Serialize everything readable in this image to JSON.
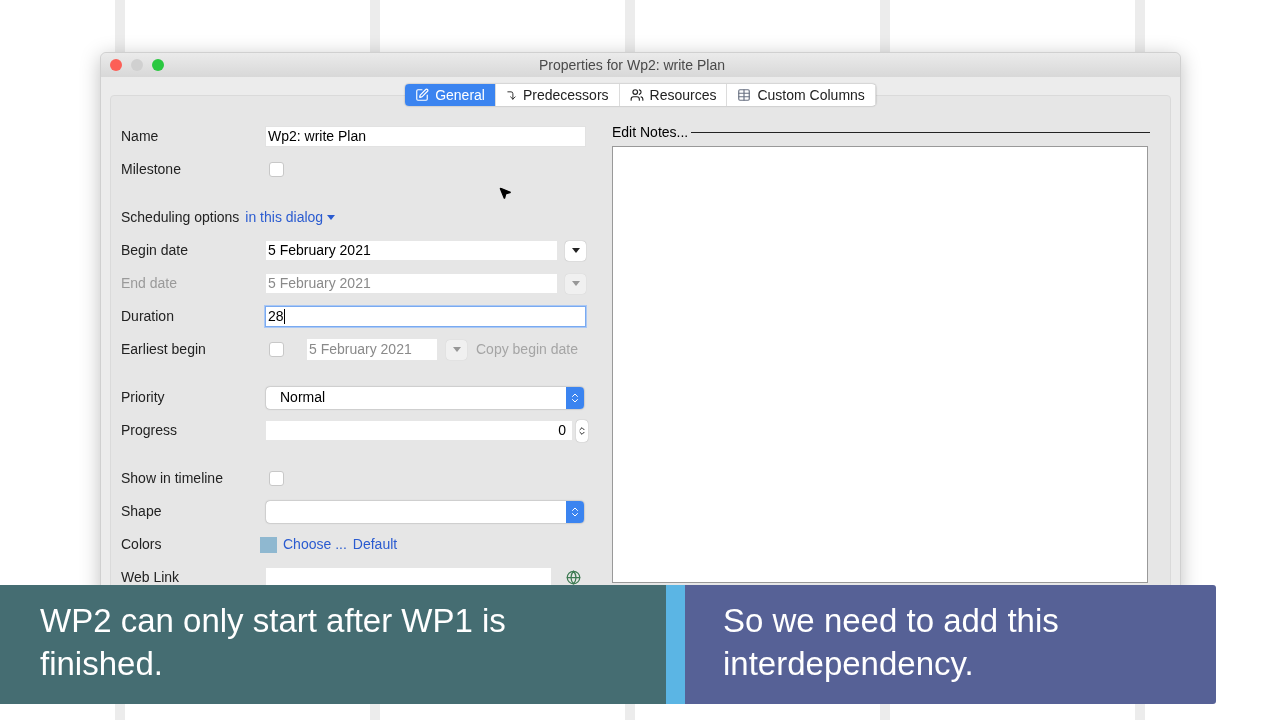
{
  "window": {
    "title": "Properties for Wp2: write Plan"
  },
  "tabs": [
    {
      "label": "General",
      "selected": true
    },
    {
      "label": "Predecessors",
      "selected": false
    },
    {
      "label": "Resources",
      "selected": false
    },
    {
      "label": "Custom Columns",
      "selected": false
    }
  ],
  "form": {
    "sections": [
      [
        {
          "kind": "text",
          "label": "Name",
          "value": "Wp2: write Plan",
          "focused": false
        },
        {
          "kind": "checkbox",
          "label": "Milestone",
          "checked": false
        }
      ],
      [
        {
          "kind": "link",
          "label": "Scheduling options",
          "link": "in this dialog"
        },
        {
          "kind": "date",
          "label": "Begin date",
          "value": "5 February 2021",
          "disabled": false
        },
        {
          "kind": "date",
          "label": "End date",
          "value": "5 February 2021",
          "disabled": true
        },
        {
          "kind": "text",
          "label": "Duration",
          "value": "28",
          "focused": true
        },
        {
          "kind": "earliest",
          "label": "Earliest begin",
          "checked": false,
          "value": "5 February 2021",
          "link": "Copy begin date"
        }
      ],
      [
        {
          "kind": "select",
          "label": "Priority",
          "value": "Normal"
        },
        {
          "kind": "spinner",
          "label": "Progress",
          "value": "0"
        }
      ],
      [
        {
          "kind": "checkbox",
          "label": "Show in timeline",
          "checked": false
        },
        {
          "kind": "select",
          "label": "Shape"
        },
        {
          "kind": "colors",
          "label": "Colors",
          "color": "#8fb8d0",
          "links": [
            "Choose ...",
            "Default"
          ]
        },
        {
          "kind": "weblink",
          "label": "Web Link"
        }
      ]
    ]
  },
  "notes": {
    "title": "Edit Notes..."
  },
  "captions": [
    {
      "text": "WP2 can only start after WP1 is finished.",
      "color": "#456d72"
    },
    {
      "text": "So we need to add this interdependency.",
      "color": "#566196"
    }
  ]
}
